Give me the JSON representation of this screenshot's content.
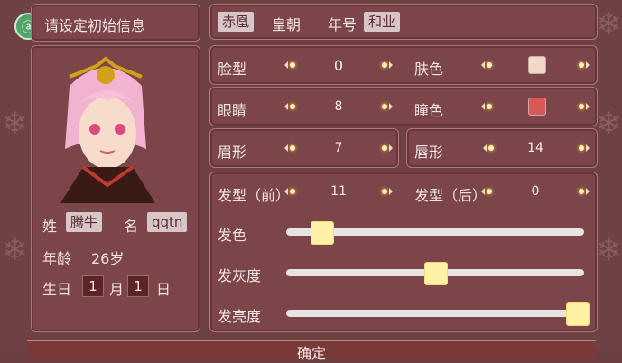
{
  "header": {
    "title": "请设定初始信息"
  },
  "dynasty": {
    "value": "赤凰",
    "label": "皇朝",
    "era_label": "年号",
    "era_value": "和业"
  },
  "profile": {
    "surname_label": "姓",
    "surname_value": "腾牛",
    "name_label": "名",
    "name_value": "qqtn",
    "age_label": "年龄",
    "age_value": "26岁",
    "birthday_label": "生日",
    "month_value": "1",
    "month_label": "月",
    "day_value": "1",
    "day_label": "日"
  },
  "attributes": [
    {
      "label": "脸型",
      "value": "0"
    },
    {
      "label": "肤色",
      "swatch_color": "#f2d8c6"
    },
    {
      "label": "眼睛",
      "value": "8"
    },
    {
      "label": "瞳色",
      "swatch_color": "#d95858"
    },
    {
      "label": "眉形",
      "value": "7"
    },
    {
      "label": "唇形",
      "value": "14"
    },
    {
      "label": "发型（前）",
      "value": "11"
    },
    {
      "label": "发型（后）",
      "value": "0"
    }
  ],
  "sliders": [
    {
      "label": "发色",
      "level": 0.1
    },
    {
      "label": "发灰度",
      "level": 0.5
    },
    {
      "label": "发亮度",
      "level": 1.0
    }
  ],
  "footer": {
    "confirm_label": "确定"
  },
  "colors": {
    "panel": "#7b4549",
    "accent": "#fff1a6",
    "background": "#6e4245"
  }
}
